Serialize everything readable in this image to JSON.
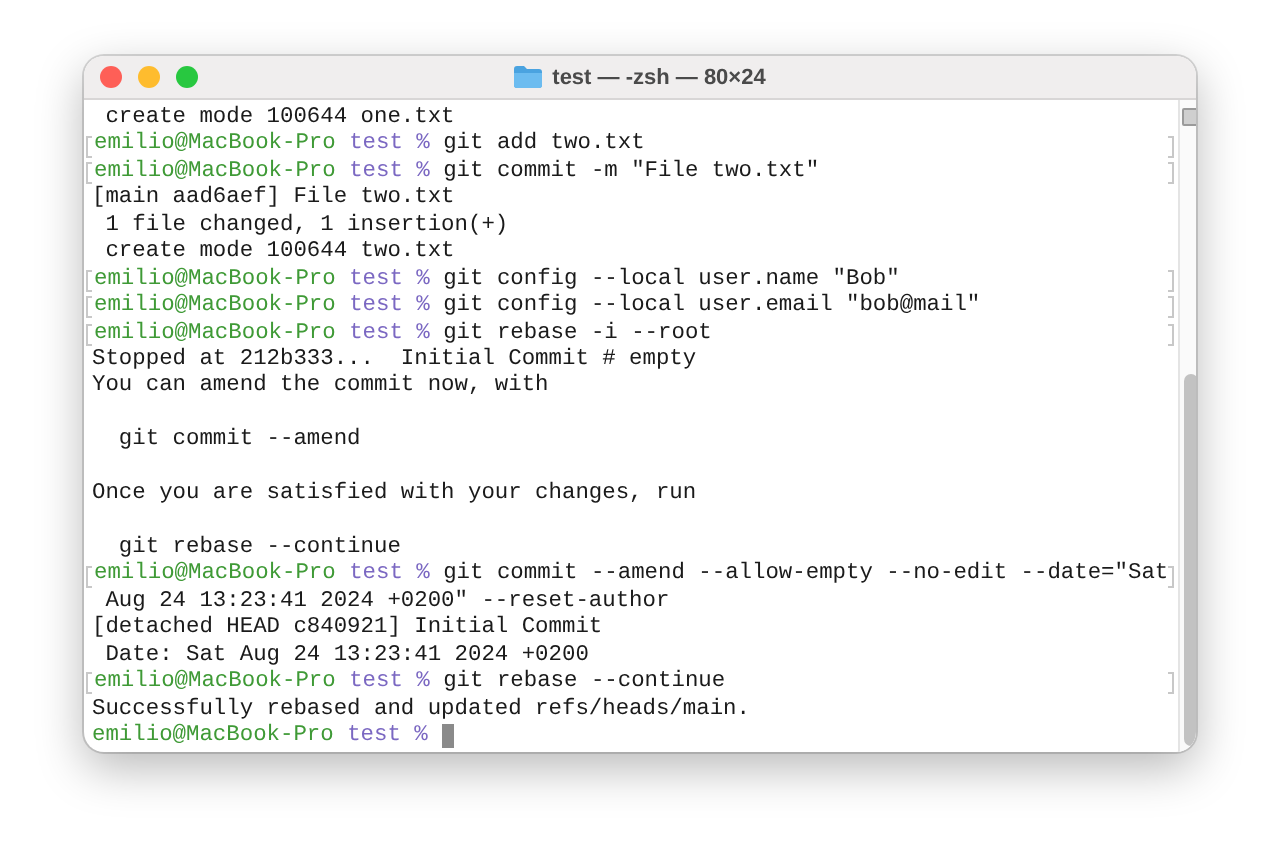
{
  "window": {
    "title": "test — -zsh — 80×24"
  },
  "lines": [
    {
      "kind": "output",
      "text": " create mode 100644 one.txt"
    },
    {
      "kind": "prompt",
      "user": "emilio@MacBook-Pro",
      "dir": "test %",
      "command": "git add two.txt",
      "marked": true
    },
    {
      "kind": "prompt",
      "user": "emilio@MacBook-Pro",
      "dir": "test %",
      "command": "git commit -m \"File two.txt\"",
      "marked": true
    },
    {
      "kind": "output",
      "text": "[main aad6aef] File two.txt"
    },
    {
      "kind": "output",
      "text": " 1 file changed, 1 insertion(+)"
    },
    {
      "kind": "output",
      "text": " create mode 100644 two.txt"
    },
    {
      "kind": "prompt",
      "user": "emilio@MacBook-Pro",
      "dir": "test %",
      "command": "git config --local user.name \"Bob\"",
      "marked": true
    },
    {
      "kind": "prompt",
      "user": "emilio@MacBook-Pro",
      "dir": "test %",
      "command": "git config --local user.email \"bob@mail\"",
      "marked": true
    },
    {
      "kind": "prompt",
      "user": "emilio@MacBook-Pro",
      "dir": "test %",
      "command": "git rebase -i --root",
      "marked": true
    },
    {
      "kind": "output",
      "text": "Stopped at 212b333...  Initial Commit # empty"
    },
    {
      "kind": "output",
      "text": "You can amend the commit now, with"
    },
    {
      "kind": "blank"
    },
    {
      "kind": "output",
      "text": "  git commit --amend"
    },
    {
      "kind": "blank"
    },
    {
      "kind": "output",
      "text": "Once you are satisfied with your changes, run"
    },
    {
      "kind": "blank"
    },
    {
      "kind": "output",
      "text": "  git rebase --continue"
    },
    {
      "kind": "prompt",
      "user": "emilio@MacBook-Pro",
      "dir": "test %",
      "command": "git commit --amend --allow-empty --no-edit --date=\"Sat",
      "marked": true
    },
    {
      "kind": "output",
      "text": " Aug 24 13:23:41 2024 +0200\" --reset-author"
    },
    {
      "kind": "output",
      "text": "[detached HEAD c840921] Initial Commit"
    },
    {
      "kind": "output",
      "text": " Date: Sat Aug 24 13:23:41 2024 +0200"
    },
    {
      "kind": "prompt",
      "user": "emilio@MacBook-Pro",
      "dir": "test %",
      "command": "git rebase --continue",
      "marked": true
    },
    {
      "kind": "output",
      "text": "Successfully rebased and updated refs/heads/main."
    },
    {
      "kind": "prompt",
      "user": "emilio@MacBook-Pro",
      "dir": "test %",
      "marked": false,
      "cursor": true
    }
  ]
}
